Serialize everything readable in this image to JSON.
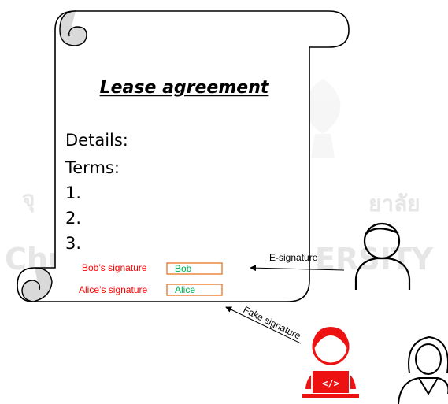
{
  "watermark": {
    "left_text": "จุ",
    "right_text": "ยาลัย",
    "bottom_left": "Chu",
    "bottom_right": "ERSITY"
  },
  "document": {
    "title": "Lease agreement",
    "lines": [
      "Details:",
      "Terms:",
      "1.",
      "2.",
      "3."
    ],
    "signatures": [
      {
        "label": "Bob’s signature",
        "value": "Bob"
      },
      {
        "label": "Alice’s signature",
        "value": "Alice"
      }
    ]
  },
  "arrows": {
    "esignature": "E-signature",
    "fake": "Fake signature"
  },
  "colors": {
    "label_red": "#ff0000",
    "value_green": "#00b050",
    "box_orange": "#ed7d31",
    "attacker_red": "#ee1111",
    "scroll_gray": "#d9d9d9"
  },
  "actors": {
    "bob": "person-icon",
    "attacker": "hacker-laptop-icon",
    "alice": "woman-icon"
  }
}
